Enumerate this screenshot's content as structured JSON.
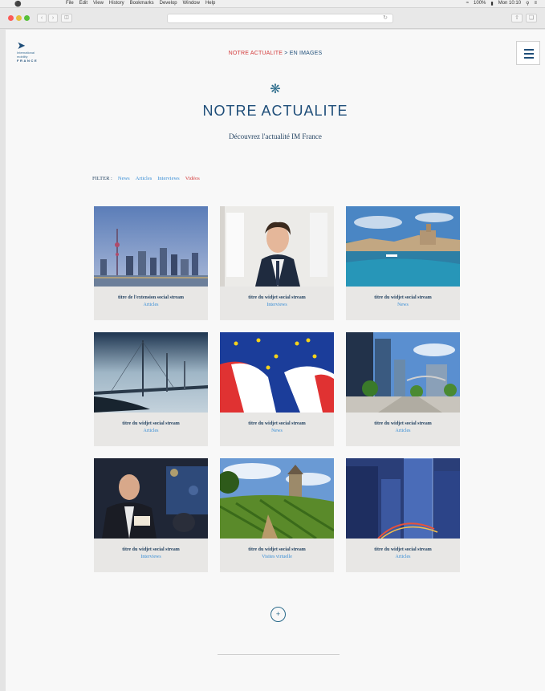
{
  "os_menubar": {
    "apple": "",
    "items": [
      "File",
      "Edit",
      "View",
      "History",
      "Bookmarks",
      "Develop",
      "Window",
      "Help"
    ],
    "battery": "100%",
    "clock": "Mon 10:10"
  },
  "header": {
    "logo_line1": "International",
    "logo_line2": "mobility",
    "logo_line3": "FRANCE",
    "breadcrumb_current": "NOTRE ACTUALITE",
    "breadcrumb_sep": " > ",
    "breadcrumb_next": "EN IMAGES"
  },
  "main": {
    "title": "NOTRE ACTUALITE",
    "subtitle": "Découvrez l'actualité IM France"
  },
  "filter": {
    "label": "FILTER :",
    "options": [
      "News",
      "Articles",
      "Interviews",
      "Vidéos"
    ],
    "active": "Vidéos"
  },
  "cards": [
    {
      "title": "titre de l'extension social stream",
      "category": "Articles",
      "image": "city-skyline"
    },
    {
      "title": "titre du widjet social stream",
      "category": "Interviews",
      "image": "man-portrait"
    },
    {
      "title": "titre du widjet social stream",
      "category": "News",
      "image": "harbor-fort"
    },
    {
      "title": "titre du widjet social stream",
      "category": "Articles",
      "image": "bridge-viaduct"
    },
    {
      "title": "titre du widjet social stream",
      "category": "News",
      "image": "flags-france-eu"
    },
    {
      "title": "titre du widjet social stream",
      "category": "Articles",
      "image": "business-district"
    },
    {
      "title": "titre du widjet social stream",
      "category": "Interviews",
      "image": "man-conference"
    },
    {
      "title": "titre du widjet social stream",
      "category": "Visites virtuelle",
      "image": "vineyard"
    },
    {
      "title": "titre du widjet social stream",
      "category": "Articles",
      "image": "glass-towers"
    }
  ],
  "load_more": "+"
}
